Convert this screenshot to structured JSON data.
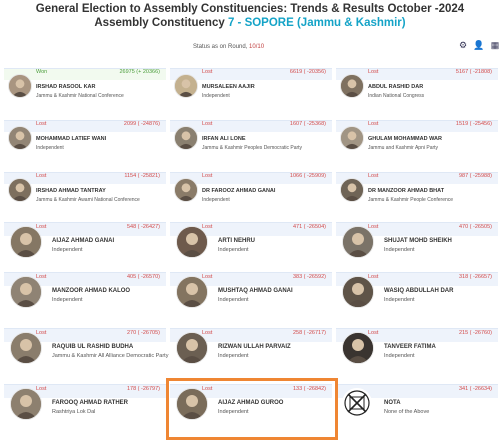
{
  "header": {
    "line1": "General Election to Assembly Constituencies: Trends & Results October -2024",
    "line2_prefix": "Assembly Constituency ",
    "line2_accent": "7 - SOPORE (Jammu & Kashmir)",
    "status_prefix": "Status as on Round, ",
    "status_round": "10/10"
  },
  "toolbar": {
    "icons": [
      "chart-settings-icon",
      "user-settings-icon",
      "grid-view-icon"
    ]
  },
  "candidates": [
    {
      "status": "Won",
      "votes": "26975 (+ 20366)",
      "name": "IRSHAD RASOOL KAR",
      "party": "Jammu & Kashmir National Conference",
      "photo": "#a99580"
    },
    {
      "status": "Lost",
      "votes": "6619 ( -20356)",
      "name": "MURSALEEN AAJIR",
      "party": "Independent",
      "photo": "#c4b18f"
    },
    {
      "status": "Lost",
      "votes": "5167 ( -21808)",
      "name": "ABDUL RASHID DAR",
      "party": "Indian National Congress",
      "photo": "#7f7160"
    },
    {
      "status": "Lost",
      "votes": "2099 ( -24876)",
      "name": "MOHAMMAD LATIEF WANI",
      "party": "Independent",
      "photo": "#928575"
    },
    {
      "status": "Lost",
      "votes": "1607 ( -25368)",
      "name": "IRFAN ALI LONE",
      "party": "Jammu & Kashmir Peoples Democratic Party",
      "photo": "#8a8070"
    },
    {
      "status": "Lost",
      "votes": "1519 ( -25456)",
      "name": "GHULAM MOHAMMAD WAR",
      "party": "Jammu and Kashmir Apni Party",
      "photo": "#a19584"
    },
    {
      "status": "Lost",
      "votes": "1154 ( -25821)",
      "name": "IRSHAD AHMAD TANTRAY",
      "party": "Jammu & Kashmir Awami National Conference",
      "photo": "#7d6f5e"
    },
    {
      "status": "Lost",
      "votes": "1066 ( -25909)",
      "name": "DR FAROOZ AHMAD GANAI",
      "party": "Independent",
      "photo": "#8a7b68"
    },
    {
      "status": "Lost",
      "votes": "987 ( -25988)",
      "name": "DR MANZOOR AHMAD BHAT",
      "party": "Jammu & Kashmir People Conference",
      "photo": "#6f6456"
    },
    {
      "status": "Lost",
      "votes": "548 ( -26427)",
      "name": "AIJAZ AHMAD GANAI",
      "party": "Independent",
      "photo": "#857764"
    },
    {
      "status": "Lost",
      "votes": "471 ( -26504)",
      "name": "ARTI NEHRU",
      "party": "Independent",
      "photo": "#6e5a4c"
    },
    {
      "status": "Lost",
      "votes": "470 ( -26505)",
      "name": "SHUJAT MOHD SHEIKH",
      "party": "Independent",
      "photo": "#7b7368"
    },
    {
      "status": "Lost",
      "votes": "405 ( -26570)",
      "name": "MANZOOR AHMAD KALOO",
      "party": "Independent",
      "photo": "#8f8374"
    },
    {
      "status": "Lost",
      "votes": "383 ( -26592)",
      "name": "MUSHTAQ AHMAD GANAI",
      "party": "Independent",
      "photo": "#837460"
    },
    {
      "status": "Lost",
      "votes": "318 ( -26657)",
      "name": "WASIQ ABDULLAH DAR",
      "party": "Independent",
      "photo": "#5f5448"
    },
    {
      "status": "Lost",
      "votes": "270 ( -26705)",
      "name": "RAQUIB UL RASHID BUDHA",
      "party": "Jammu & Kashmir All Alliance Democratic Party",
      "photo": "#8a7d6c"
    },
    {
      "status": "Lost",
      "votes": "258 ( -26717)",
      "name": "RIZWAN ULLAH PARVAIZ",
      "party": "Independent",
      "photo": "#6b5f52"
    },
    {
      "status": "Lost",
      "votes": "215 ( -26760)",
      "name": "TANVEER FATIMA",
      "party": "Independent",
      "photo": "#3a3430"
    },
    {
      "status": "Lost",
      "votes": "178 ( -26797)",
      "name": "FAROOQ AHMAD RATHER",
      "party": "Rashtriya Lok Dal",
      "photo": "#8d806f"
    },
    {
      "status": "Lost",
      "votes": "133 ( -26842)",
      "name": "AIJAZ AHMAD GUROO",
      "party": "Independent",
      "photo": "#7a6c5a"
    },
    {
      "status": "",
      "votes": "341 ( -26634)",
      "name": "NOTA",
      "party": "None of the Above",
      "photo": "#ffffff"
    }
  ],
  "colors": {
    "accent": "#14a3c7",
    "won": "#4a9d3a",
    "lost": "#d34a4a",
    "highlight": "#ef8633"
  }
}
